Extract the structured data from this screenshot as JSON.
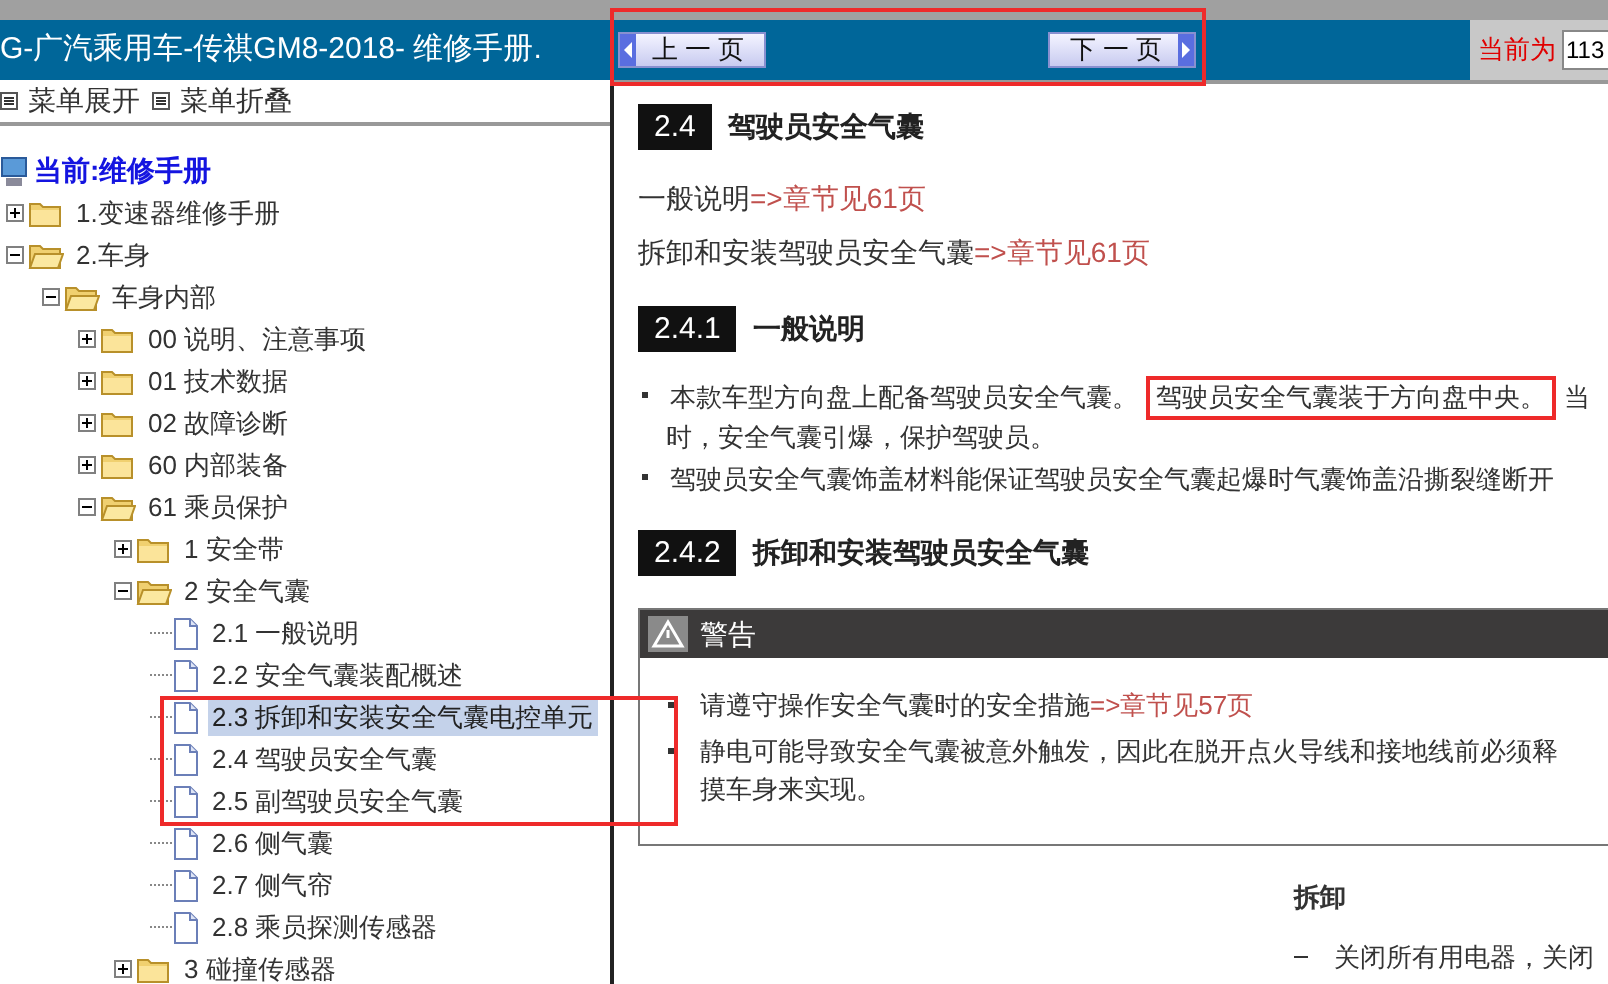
{
  "tree_pane": {
    "title": "G-广汽乘用车-传祺GM8-2018- 维修手册.",
    "menu_buttons": [
      "菜单展开",
      "菜单折叠"
    ],
    "root_label": "当前:维修手册",
    "tree": [
      {
        "label": "1.变速器维修手册",
        "kind": "folder",
        "expanded": false,
        "selected": false,
        "boxed": false
      },
      {
        "label": "2.车身",
        "kind": "folder",
        "expanded": true,
        "selected": false,
        "boxed": false,
        "children": [
          {
            "label": "车身内部",
            "kind": "folder",
            "expanded": true,
            "selected": false,
            "boxed": false,
            "children": [
              {
                "label": "00 说明、注意事项",
                "kind": "folder",
                "expanded": false,
                "selected": false,
                "boxed": false
              },
              {
                "label": "01 技术数据",
                "kind": "folder",
                "expanded": false,
                "selected": false,
                "boxed": false
              },
              {
                "label": "02 故障诊断",
                "kind": "folder",
                "expanded": false,
                "selected": false,
                "boxed": false
              },
              {
                "label": "60 内部装备",
                "kind": "folder",
                "expanded": false,
                "selected": false,
                "boxed": false
              },
              {
                "label": "61 乘员保护",
                "kind": "folder",
                "expanded": true,
                "selected": false,
                "boxed": false,
                "children": [
                  {
                    "label": "1 安全带",
                    "kind": "folder",
                    "expanded": false,
                    "selected": false,
                    "boxed": false
                  },
                  {
                    "label": "2 安全气囊",
                    "kind": "folder",
                    "expanded": true,
                    "selected": false,
                    "boxed": false,
                    "children": [
                      {
                        "label": "2.1 一般说明",
                        "kind": "page",
                        "selected": false,
                        "boxed": false
                      },
                      {
                        "label": "2.2 安全气囊装配概述",
                        "kind": "page",
                        "selected": false,
                        "boxed": false
                      },
                      {
                        "label": "2.3 拆卸和安装安全气囊电控单元",
                        "kind": "page",
                        "selected": true,
                        "boxed": true
                      },
                      {
                        "label": "2.4 驾驶员安全气囊",
                        "kind": "page",
                        "selected": false,
                        "boxed": true
                      },
                      {
                        "label": "2.5 副驾驶员安全气囊",
                        "kind": "page",
                        "selected": false,
                        "boxed": true
                      },
                      {
                        "label": "2.6 侧气囊",
                        "kind": "page",
                        "selected": false,
                        "boxed": false
                      },
                      {
                        "label": "2.7 侧气帘",
                        "kind": "page",
                        "selected": false,
                        "boxed": false
                      },
                      {
                        "label": "2.8 乘员探测传感器",
                        "kind": "page",
                        "selected": false,
                        "boxed": false
                      }
                    ]
                  },
                  {
                    "label": "3 碰撞传感器",
                    "kind": "folder",
                    "expanded": false,
                    "selected": false,
                    "boxed": false
                  }
                ]
              }
            ]
          }
        ]
      }
    ]
  },
  "nav": {
    "boxed": true,
    "prev": "上 一 页",
    "next": "下 一 页"
  },
  "page_indicator": {
    "label": "当前为",
    "value": "113"
  },
  "document": {
    "heading": {
      "number": "2.4",
      "title": "驾驶员安全气囊"
    },
    "references": [
      {
        "text": "一般说明",
        "link": "=>章节见61页"
      },
      {
        "text": "拆卸和安装驾驶员安全气囊",
        "link": "=>章节见61页"
      }
    ],
    "section_1": {
      "number": "2.4.1",
      "title": "一般说明"
    },
    "bullets": [
      {
        "parts": [
          {
            "text": "本款车型方向盘上配备驾驶员安全气囊。",
            "boxed": false
          },
          {
            "text": "驾驶员安全气囊装于方向盘中央。",
            "boxed": true
          },
          {
            "text": "当",
            "boxed": false
          }
        ],
        "continuation": "时，安全气囊引爆，保护驾驶员。"
      },
      {
        "parts": [
          {
            "text": "驾驶员安全气囊饰盖材料能保证驾驶员安全气囊起爆时气囊饰盖沿撕裂缝断开",
            "boxed": false
          }
        ]
      }
    ],
    "section_2": {
      "number": "2.4.2",
      "title": "拆卸和安装驾驶员安全气囊"
    },
    "warning": {
      "title": "警告",
      "items": [
        {
          "lines": [
            "请遵守操作安全气囊时的安全措施"
          ],
          "link": "=>章节见57页"
        },
        {
          "lines": [
            "静电可能导致安全气囊被意外触发，因此在脱开点火导线和接地线前必须释",
            "摸车身来实现。"
          ]
        }
      ]
    },
    "removal": {
      "title": "拆卸",
      "steps": [
        "关闭所有用电器，关闭"
      ]
    }
  }
}
